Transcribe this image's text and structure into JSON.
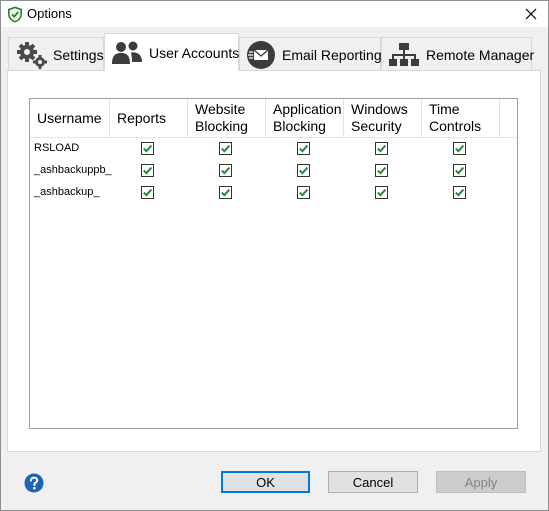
{
  "window": {
    "title": "Options",
    "close_glyph": "✕"
  },
  "tabs": [
    {
      "label": "Settings",
      "icon": "gears-icon",
      "selected": false
    },
    {
      "label": "User Accounts",
      "icon": "users-icon",
      "selected": true
    },
    {
      "label": "Email Reporting",
      "icon": "email-icon",
      "selected": false
    },
    {
      "label": "Remote Manager",
      "icon": "network-icon",
      "selected": false
    }
  ],
  "grid": {
    "columns": [
      {
        "line1": "Username",
        "line2": ""
      },
      {
        "line1": "Reports",
        "line2": ""
      },
      {
        "line1": "Website",
        "line2": "Blocking"
      },
      {
        "line1": "Application",
        "line2": "Blocking"
      },
      {
        "line1": "Windows",
        "line2": "Security"
      },
      {
        "line1": "Time",
        "line2": "Controls"
      }
    ],
    "rows": [
      {
        "username": "RSLOAD",
        "reports": true,
        "website_blocking": true,
        "application_blocking": true,
        "windows_security": true,
        "time_controls": true
      },
      {
        "username": "_ashbackuppb_",
        "reports": true,
        "website_blocking": true,
        "application_blocking": true,
        "windows_security": true,
        "time_controls": true
      },
      {
        "username": "_ashbackup_",
        "reports": true,
        "website_blocking": true,
        "application_blocking": true,
        "windows_security": true,
        "time_controls": true
      }
    ]
  },
  "footer": {
    "help_icon": "help-icon",
    "ok_label": "OK",
    "cancel_label": "Cancel",
    "apply_label": "Apply",
    "apply_enabled": false
  },
  "colors": {
    "accent": "#0078d7",
    "check_green": "#1e8c3a",
    "help_blue": "#1f63b5"
  }
}
